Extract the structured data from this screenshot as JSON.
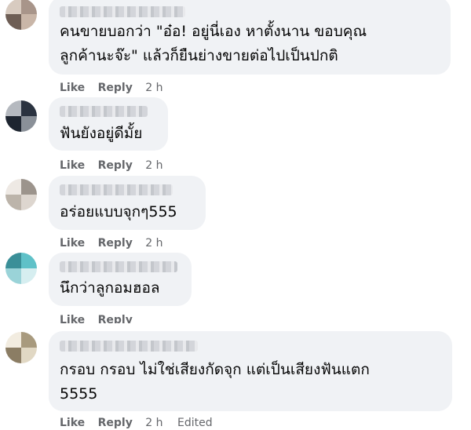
{
  "comments": [
    {
      "text": "คนขายบอกว่า \"อ๋อ! อยู่นี่เอง หาตั้งนาน ขอบคุณ\nลูกค้านะจ๊ะ\" แล้วก็ยืนย่างขายต่อไปเป็นปกติ",
      "like": "Like",
      "reply": "Reply",
      "time": "2 h",
      "edited": ""
    },
    {
      "text": "ฟันยังอยู่ดีมั้ย",
      "like": "Like",
      "reply": "Reply",
      "time": "2 h",
      "edited": ""
    },
    {
      "text": "อร่อยแบบจุกๆ555",
      "like": "Like",
      "reply": "Reply",
      "time": "2 h",
      "edited": ""
    },
    {
      "text": "นึกว่าลูกอมฮอล",
      "like": "Like",
      "reply": "Reply",
      "time": "",
      "edited": ""
    },
    {
      "text": "กรอบ กรอบ ไม่ใช่เสียงกัดจุก แต่เป็นเสียงฟันแตก\n5555",
      "like": "Like",
      "reply": "Reply",
      "time": "2 h",
      "edited": "Edited"
    }
  ],
  "colors": {
    "bubble": "#f0f2f5",
    "text": "#050505",
    "meta": "#65676b"
  }
}
